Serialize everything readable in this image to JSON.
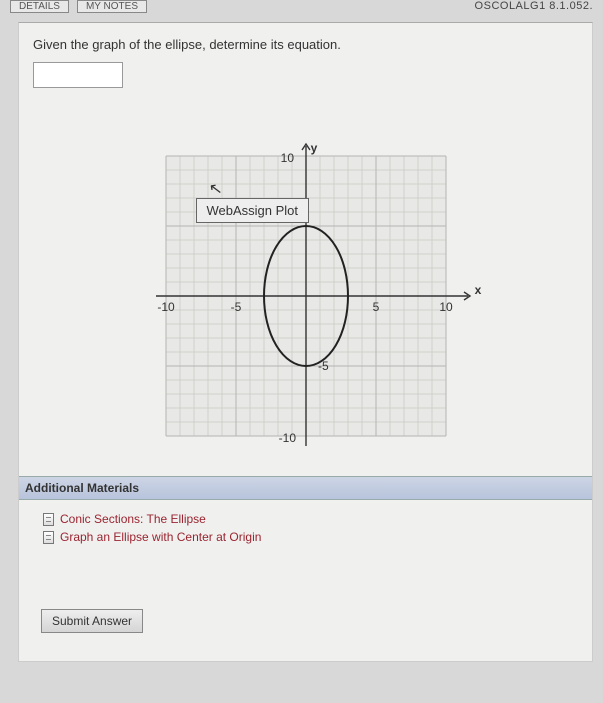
{
  "top": {
    "btn_details": "DETAILS",
    "btn_mynotes": "MY NOTES",
    "course_code": "OSCOLALG1 8.1.052."
  },
  "prompt": "Given the graph of the ellipse, determine its equation.",
  "plot_label": "WebAssign Plot",
  "axis": {
    "x_label": "x",
    "y_label": "y",
    "ticks": {
      "xn10": "-10",
      "xn5": "-5",
      "x5": "5",
      "x10": "10",
      "y10": "10",
      "yn5": "-5",
      "yn10": "-10"
    }
  },
  "additional_heading": "Additional Materials",
  "materials": {
    "m1": "Conic Sections: The Ellipse",
    "m2": "Graph an Ellipse with Center at Origin"
  },
  "submit_label": "Submit Answer",
  "chart_data": {
    "type": "scatter",
    "title": "WebAssign Plot",
    "xlabel": "x",
    "ylabel": "y",
    "xlim": [
      -10,
      10
    ],
    "ylim": [
      -10,
      10
    ],
    "shape": "ellipse",
    "center": [
      0,
      0
    ],
    "semi_axis_x": 3,
    "semi_axis_y": 5,
    "annotations": [
      "Vertical major axis ellipse centered at origin"
    ]
  }
}
